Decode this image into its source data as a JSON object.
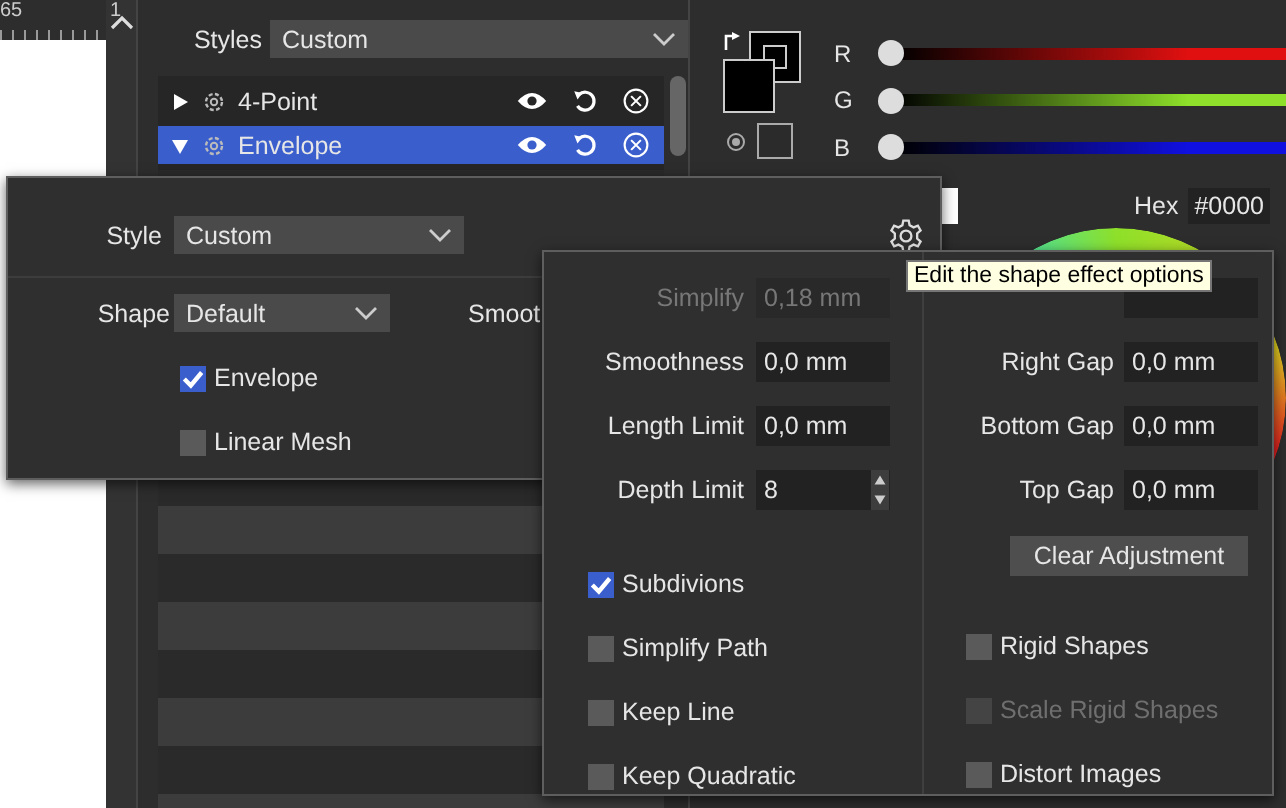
{
  "ruler": {
    "labels": [
      "65",
      "1"
    ]
  },
  "styles_panel": {
    "label": "Styles",
    "value": "Custom",
    "effects": [
      {
        "name": "4-Point",
        "expanded": false,
        "selected": false
      },
      {
        "name": "Envelope",
        "expanded": true,
        "selected": true
      }
    ]
  },
  "color_panel": {
    "channels": [
      {
        "name": "R",
        "level": 0,
        "color": "#e01010"
      },
      {
        "name": "G",
        "level": 0,
        "color": "#8ee02a"
      },
      {
        "name": "B",
        "level": 0,
        "color": "#1010e0"
      }
    ],
    "hex_label": "Hex",
    "hex_value": "#0000"
  },
  "style_popup": {
    "style_label": "Style",
    "style_value": "Custom",
    "shape_label": "Shape",
    "shape_value": "Default",
    "cut_label": "Smoot",
    "options": [
      {
        "label": "Envelope",
        "checked": true
      },
      {
        "label": "Linear Mesh",
        "checked": false
      }
    ]
  },
  "effect_options": {
    "fields": [
      {
        "label": "Simplify",
        "value": "0,18 mm",
        "disabled": true,
        "kind": "text"
      },
      {
        "label": "Smoothness",
        "value": "0,0 mm",
        "disabled": false,
        "kind": "text"
      },
      {
        "label": "Length Limit",
        "value": "0,0 mm",
        "disabled": false,
        "kind": "text"
      },
      {
        "label": "Depth Limit",
        "value": "8",
        "disabled": false,
        "kind": "spinner"
      }
    ],
    "gaps": [
      {
        "label": "Right Gap",
        "value": "0,0 mm"
      },
      {
        "label": "Bottom Gap",
        "value": "0,0 mm"
      },
      {
        "label": "Top Gap",
        "value": "0,0 mm"
      }
    ],
    "button": "Clear Adjustment",
    "left_checks": [
      {
        "label": "Subdivions",
        "checked": true,
        "disabled": false
      },
      {
        "label": "Simplify Path",
        "checked": false,
        "disabled": false
      },
      {
        "label": "Keep Line",
        "checked": false,
        "disabled": false
      },
      {
        "label": "Keep Quadratic",
        "checked": false,
        "disabled": false
      }
    ],
    "right_checks": [
      {
        "label": "Rigid Shapes",
        "checked": false,
        "disabled": false
      },
      {
        "label": "Scale Rigid Shapes",
        "checked": false,
        "disabled": true
      },
      {
        "label": "Distort Images",
        "checked": false,
        "disabled": false
      }
    ]
  },
  "tooltip": "Edit the shape effect options"
}
